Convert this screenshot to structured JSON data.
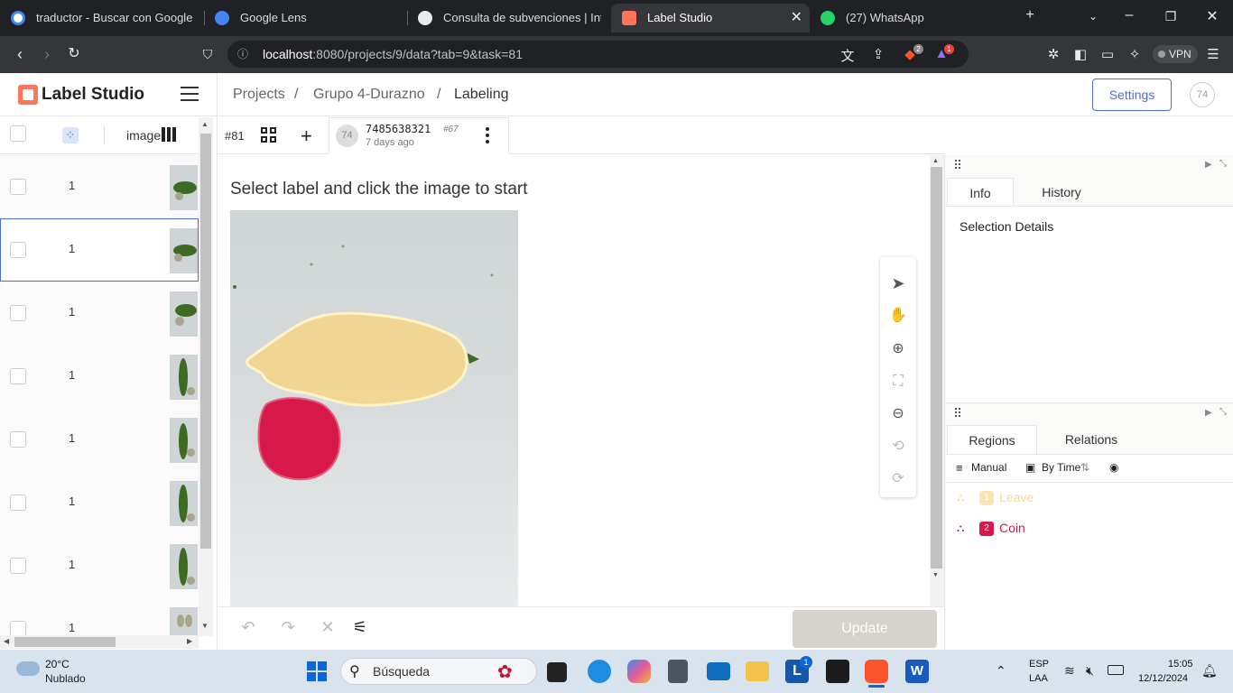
{
  "browser": {
    "tabs": [
      {
        "title": "traductor - Buscar con Google",
        "favicon": "google-icon"
      },
      {
        "title": "Google Lens",
        "favicon": "lens-icon"
      },
      {
        "title": "Consulta de subvenciones | Intran",
        "favicon": "p-icon"
      },
      {
        "title": "Label Studio",
        "favicon": "label-studio-icon",
        "active": true
      },
      {
        "title": "(27) WhatsApp",
        "favicon": "whatsapp-icon"
      }
    ],
    "url_host": "localhost",
    "url_path": ":8080/projects/9/data?tab=9&task=81",
    "brave_badge": "2",
    "alert_badge": "1",
    "vpn_label": "VPN"
  },
  "app": {
    "logo_text": "Label Studio",
    "breadcrumb": [
      "Projects",
      "Grupo 4-Durazno",
      "Labeling"
    ],
    "breadcrumb_sep": "/",
    "settings_label": "Settings",
    "user_initials": "74"
  },
  "list": {
    "column_image_label": "image",
    "rows": [
      {
        "count": "1"
      },
      {
        "count": "1",
        "selected": true
      },
      {
        "count": "1"
      },
      {
        "count": "1"
      },
      {
        "count": "1"
      },
      {
        "count": "1"
      },
      {
        "count": "1"
      },
      {
        "count": "1"
      }
    ]
  },
  "task": {
    "id": "#81",
    "annotation_user": "74",
    "annotation_id": "7485638321",
    "annotation_num": "#67",
    "annotation_time": "7 days ago"
  },
  "canvas": {
    "instruction": "Select label and click the image to start"
  },
  "controls": {
    "update_label": "Update"
  },
  "right_panel": {
    "tabs": [
      "Info",
      "History"
    ],
    "selection_title": "Selection Details",
    "lower_tabs": [
      "Regions",
      "Relations"
    ],
    "sort_manual": "Manual",
    "sort_by_time": "By Time",
    "regions": [
      {
        "num": "1",
        "label": "Leave",
        "color": "#f5d38a",
        "dim": true
      },
      {
        "num": "2",
        "label": "Coin",
        "color": "#d7194a"
      }
    ]
  },
  "taskbar": {
    "weather_temp": "20°C",
    "weather_desc": "Nublado",
    "search_placeholder": "Búsqueda",
    "outlook_badge": "1",
    "lang1": "ESP",
    "lang2": "LAA",
    "time": "15:05",
    "date": "12/12/2024"
  }
}
